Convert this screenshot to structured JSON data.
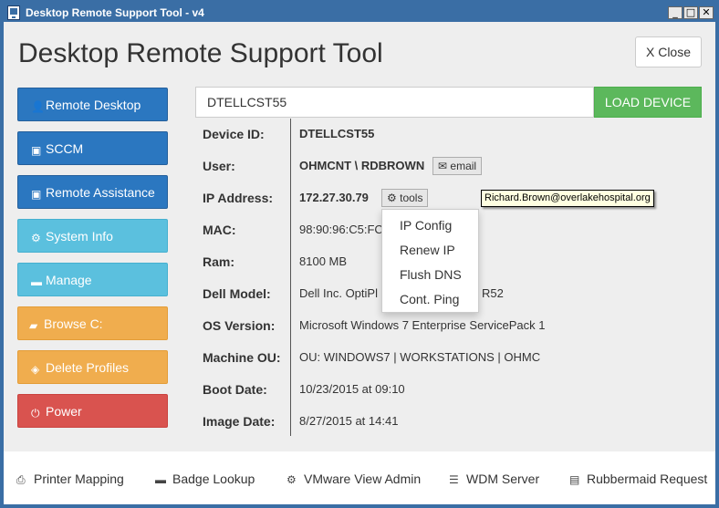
{
  "window": {
    "title": "Desktop Remote Support Tool - v4",
    "min_icon": "_",
    "max_icon": "□",
    "close_icon": "✕"
  },
  "header": {
    "title": "Desktop Remote Support Tool",
    "close_label": "X Close"
  },
  "sidebar": {
    "items": [
      {
        "label": "Remote Desktop",
        "icon": "user-icon"
      },
      {
        "label": "SCCM",
        "icon": "window-icon"
      },
      {
        "label": "Remote Assistance",
        "icon": "window-icon"
      },
      {
        "label": "System Info",
        "icon": "gear-icon"
      },
      {
        "label": "Manage",
        "icon": "monitor-icon"
      },
      {
        "label": "Browse C:",
        "icon": "folder-icon"
      },
      {
        "label": "Delete Profiles",
        "icon": "eraser-icon"
      },
      {
        "label": "Power",
        "icon": "power-icon"
      }
    ]
  },
  "search": {
    "value": "DTELLCST55",
    "load_label": "LOAD DEVICE"
  },
  "details": {
    "device_id": {
      "label": "Device ID:",
      "value": "DTELLCST55"
    },
    "user": {
      "label": "User:",
      "value": "OHMCNT \\ RDBROWN",
      "email_label": "email"
    },
    "ip": {
      "label": "IP Address:",
      "value": "172.27.30.79",
      "tools_label": "tools"
    },
    "mac": {
      "label": "MAC:",
      "value": "98:90:96:C5:FC"
    },
    "ram": {
      "label": "Ram:",
      "value": "8100 MB"
    },
    "model": {
      "label": "Dell Model:",
      "value_left": "Dell Inc. OptiPl",
      "value_right": "R52"
    },
    "os": {
      "label": "OS Version:",
      "value": "Microsoft Windows 7 Enterprise ServicePack 1"
    },
    "ou": {
      "label": "Machine OU:",
      "value": "OU: WINDOWS7 | WORKSTATIONS | OHMC"
    },
    "boot": {
      "label": "Boot Date:",
      "value": "10/23/2015 at 09:10"
    },
    "image": {
      "label": "Image Date:",
      "value": "8/27/2015 at 14:41"
    }
  },
  "tooltip": "Richard.Brown@overlakehospital.org",
  "tools_menu": [
    "IP Config",
    "Renew IP",
    "Flush DNS",
    "Cont. Ping"
  ],
  "footer": {
    "links": [
      {
        "label": "Printer Mapping",
        "icon": "printer-icon"
      },
      {
        "label": "Badge Lookup",
        "icon": "card-icon"
      },
      {
        "label": "VMware View Admin",
        "icon": "gear-icon"
      },
      {
        "label": "WDM Server",
        "icon": "list-icon"
      },
      {
        "label": "Rubbermaid Request",
        "icon": "document-icon"
      }
    ]
  },
  "colors": {
    "primary": "#2b77c0",
    "info": "#5bc0de",
    "warning": "#f0ad4e",
    "danger": "#d9534f",
    "success": "#5cb85c",
    "titlebar": "#3a6ea5"
  }
}
